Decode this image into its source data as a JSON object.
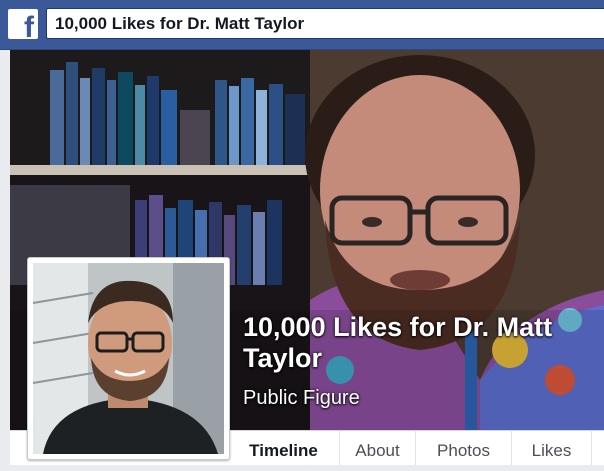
{
  "topbar": {
    "logo_icon": "facebook-f-icon",
    "search_value": "10,000 Likes for Dr. Matt Taylor"
  },
  "page": {
    "name": "10,000 Likes for Dr. Matt Taylor",
    "category": "Public Figure"
  },
  "tabs": [
    {
      "label": "Timeline",
      "active": true
    },
    {
      "label": "About",
      "active": false
    },
    {
      "label": "Photos",
      "active": false
    },
    {
      "label": "Likes",
      "active": false
    }
  ],
  "colors": {
    "brand_blue": "#3b5998",
    "page_background": "#e9ebee"
  }
}
